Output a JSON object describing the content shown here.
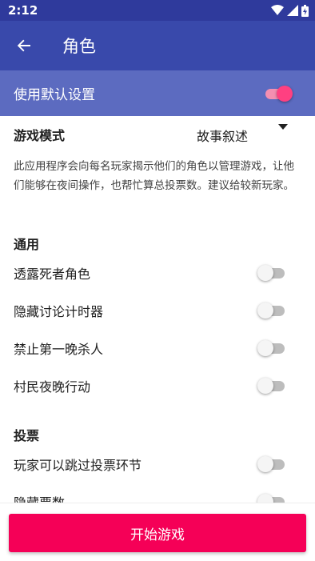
{
  "status_bar": {
    "time": "2:12"
  },
  "app_bar": {
    "title": "角色"
  },
  "default_settings": {
    "label": "使用默认设置",
    "enabled": true
  },
  "game_mode": {
    "label": "游戏模式",
    "selected": "故事叙述"
  },
  "description": "此应用程序会向每名玩家揭示他们的角色以管理游戏，让他们能够在夜间操作，也帮忙算总投票数。建议给较新玩家。",
  "sections": {
    "general": {
      "title": "通用",
      "items": [
        {
          "label": "透露死者角色",
          "enabled": false
        },
        {
          "label": "隐藏讨论计时器",
          "enabled": false
        },
        {
          "label": "禁止第一晚杀人",
          "enabled": false
        },
        {
          "label": "村民夜晚行动",
          "enabled": false
        }
      ]
    },
    "voting": {
      "title": "投票",
      "items": [
        {
          "label": "玩家可以跳过投票环节",
          "enabled": false
        },
        {
          "label": "隐藏票数",
          "enabled": false
        }
      ]
    }
  },
  "start_button": {
    "label": "开始游戏"
  },
  "colors": {
    "primary": "#3949ab",
    "primary_dark": "#2f3a9c",
    "accent": "#f50057",
    "header_band": "#5c6bc0"
  }
}
